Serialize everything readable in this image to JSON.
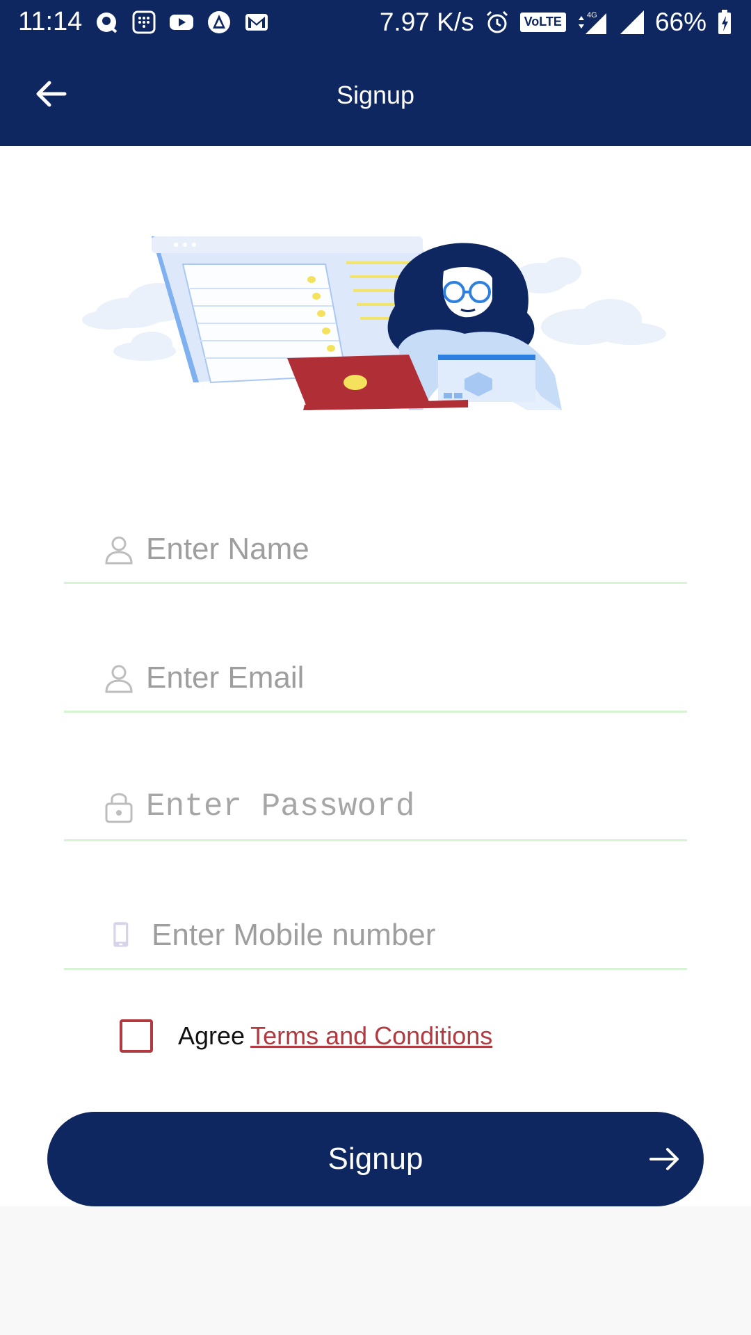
{
  "status_bar": {
    "time": "11:14",
    "net_speed": "7.97 K/s",
    "battery": "66%",
    "volte": "VoLTE",
    "network": "4G"
  },
  "app_bar": {
    "title": "Signup"
  },
  "form": {
    "name_placeholder": "Enter Name",
    "email_placeholder": "Enter Email",
    "password_placeholder": "Enter Password",
    "mobile_placeholder": "Enter Mobile number",
    "agree_text": "Agree",
    "terms_link": "Terms and Conditions",
    "terms_checked": false,
    "submit_label": "Signup"
  },
  "icons": {
    "back": "arrow-left-icon",
    "name": "person-icon",
    "email": "person-icon",
    "password": "lock-icon",
    "mobile": "phone-icon",
    "submit": "arrow-right-icon"
  },
  "colors": {
    "primary": "#0e2761",
    "accent": "#b03a3f",
    "field_underline": "#d6f3d4",
    "placeholder": "#9e9e9e"
  }
}
